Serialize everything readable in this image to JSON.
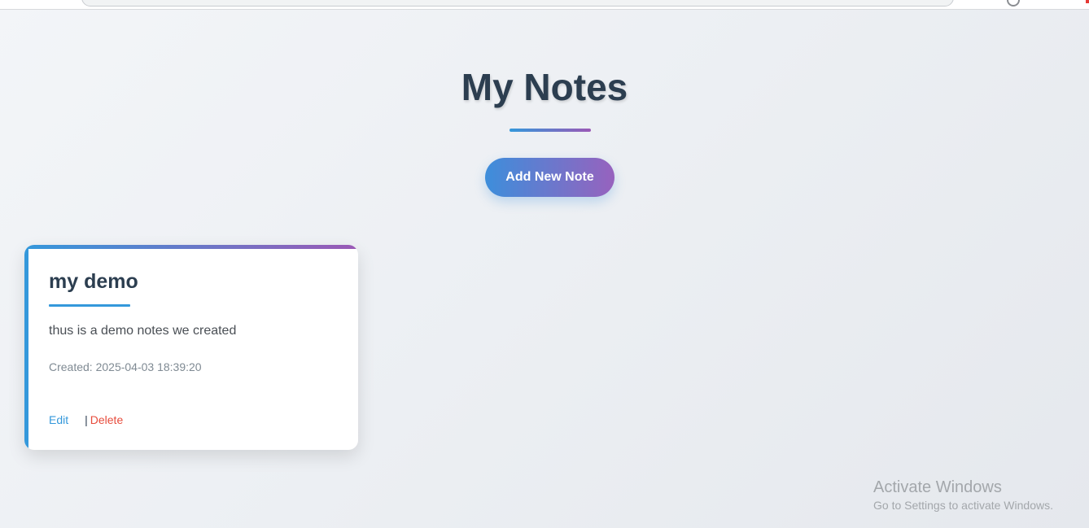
{
  "page": {
    "title": "My Notes",
    "add_button_label": "Add New Note"
  },
  "notes": [
    {
      "title": "my demo",
      "content": "thus is a demo notes we created",
      "created": "Created: 2025-04-03 18:39:20",
      "edit_label": "Edit",
      "separator": "|",
      "delete_label": "Delete"
    }
  ],
  "watermark": {
    "title": "Activate Windows",
    "subtitle": "Go to Settings to activate Windows."
  },
  "colors": {
    "heading": "#2c3e50",
    "accent_blue": "#3498db",
    "accent_purple": "#9b59b6",
    "delete_red": "#e74c3c"
  }
}
